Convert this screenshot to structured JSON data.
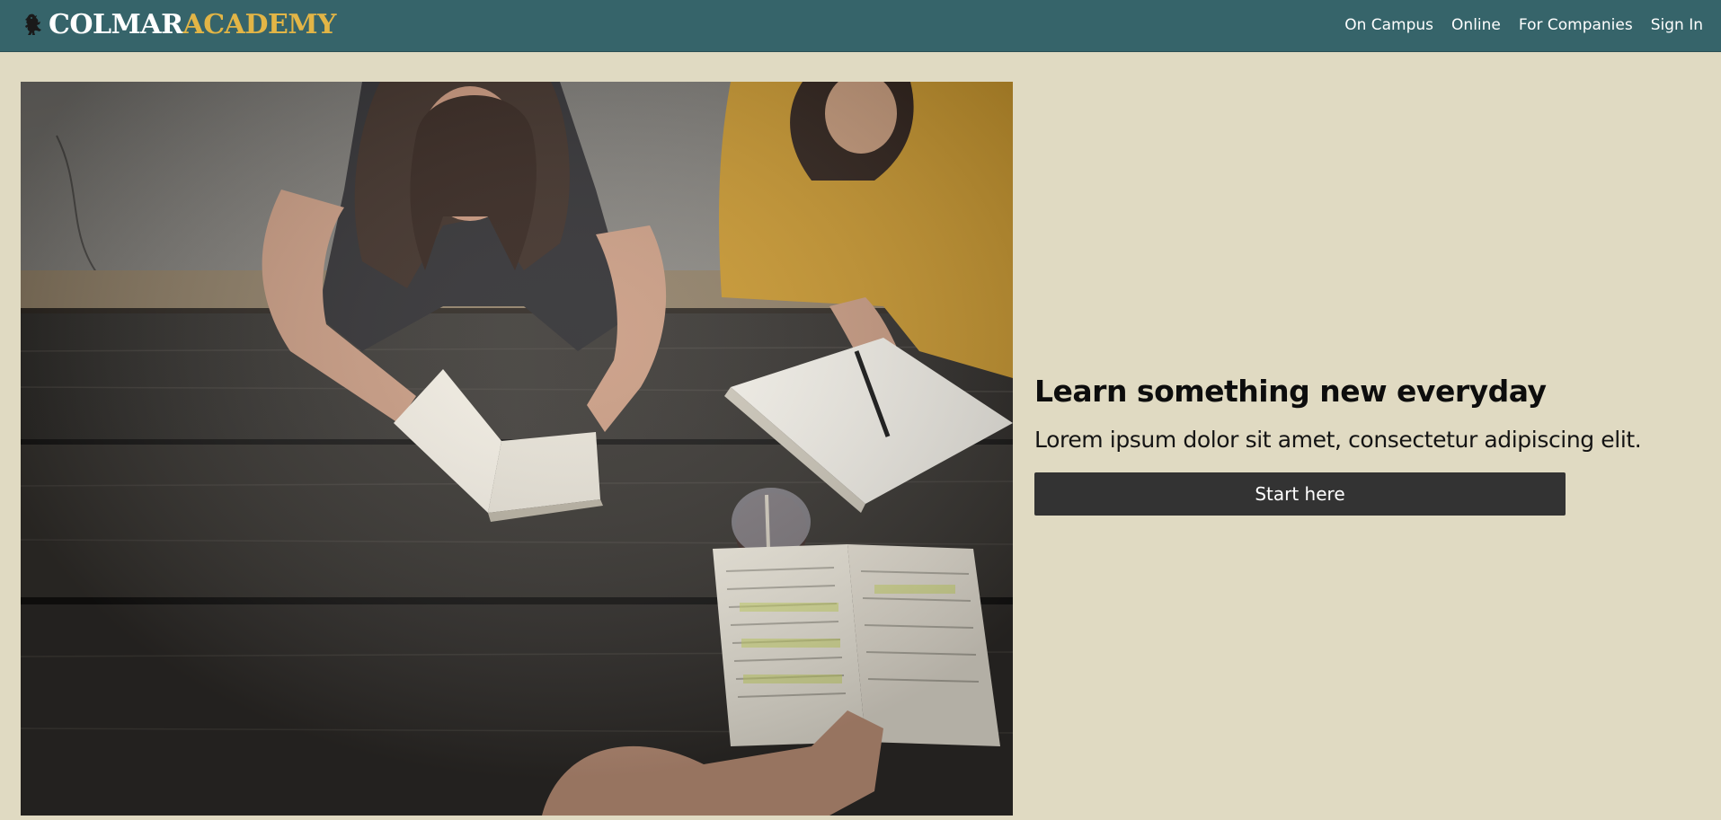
{
  "brand": {
    "part1": "COLMAR",
    "part2": "ACADEMY",
    "icon": "lion-rampant-icon",
    "colors": {
      "part1": "#ffffff",
      "part2": "#e2b546"
    }
  },
  "nav": {
    "background": "#36646a",
    "links": [
      {
        "label": "On Campus"
      },
      {
        "label": "Online"
      },
      {
        "label": "For Companies"
      },
      {
        "label": "Sign In"
      }
    ]
  },
  "hero": {
    "image_icon": "students-studying-photo",
    "title": "Learn something new everyday",
    "subtitle": "Lorem ipsum dolor sit amet, consectetur adipiscing elit.",
    "cta_label": "Start here",
    "cta_color": "#333333"
  },
  "page": {
    "background": "#e0dac2"
  }
}
